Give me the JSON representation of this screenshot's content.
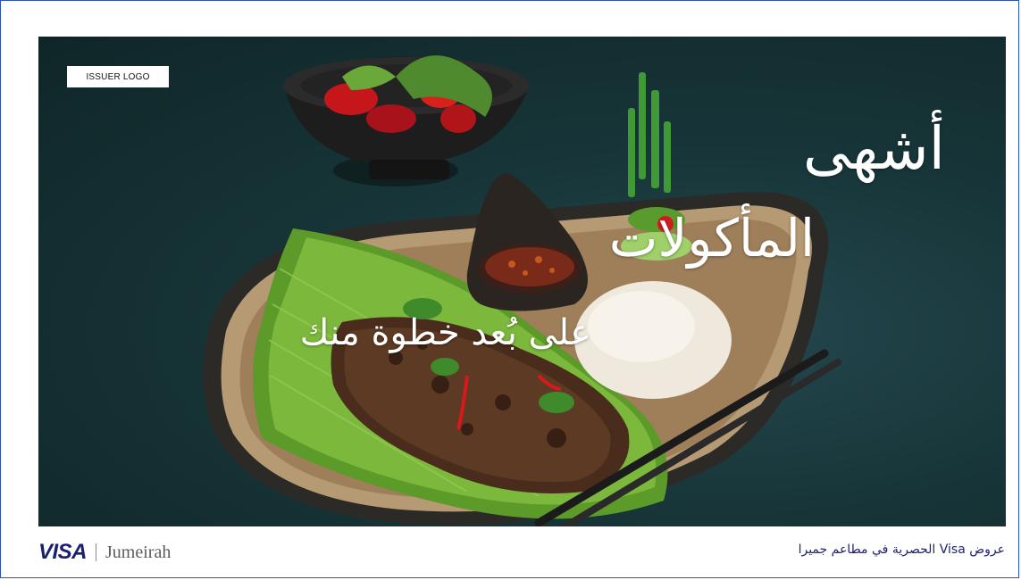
{
  "hero": {
    "issuer_logo": "ISSUER LOGO",
    "headline_line1": "أشهى",
    "headline_line2": "المأكولات",
    "headline_line3": "على بُعد خطوة منك"
  },
  "footer": {
    "brand": "VISA",
    "partner": "Jumeirah",
    "offer_text": "عروض Visa الحصرية في مطاعم جميرا"
  },
  "colors": {
    "border": "#2a50c8",
    "visa_blue": "#1a1f71",
    "background": "#173538"
  }
}
